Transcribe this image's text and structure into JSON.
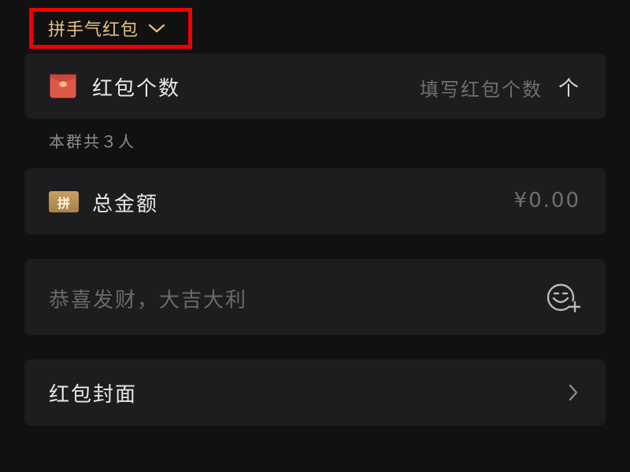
{
  "selector": {
    "label": "拼手气红包",
    "icon": "chevron-down-icon"
  },
  "count_row": {
    "label": "红包个数",
    "placeholder": "填写红包个数",
    "unit": "个",
    "icon": "red-envelope-icon"
  },
  "group_info": "本群共３人",
  "amount_row": {
    "badge": "拼",
    "label": "总金额",
    "value": "¥0.00"
  },
  "greeting": {
    "placeholder": "恭喜发财，大吉大利",
    "icon": "emoji-add-icon"
  },
  "cover_row": {
    "label": "红包封面",
    "icon": "chevron-right-icon"
  },
  "colors": {
    "background": "#111112",
    "card": "#1d1d1f",
    "accent_gold": "#e7c27f",
    "highlight_frame": "#f00000",
    "envelope_red": "#e0574a"
  }
}
